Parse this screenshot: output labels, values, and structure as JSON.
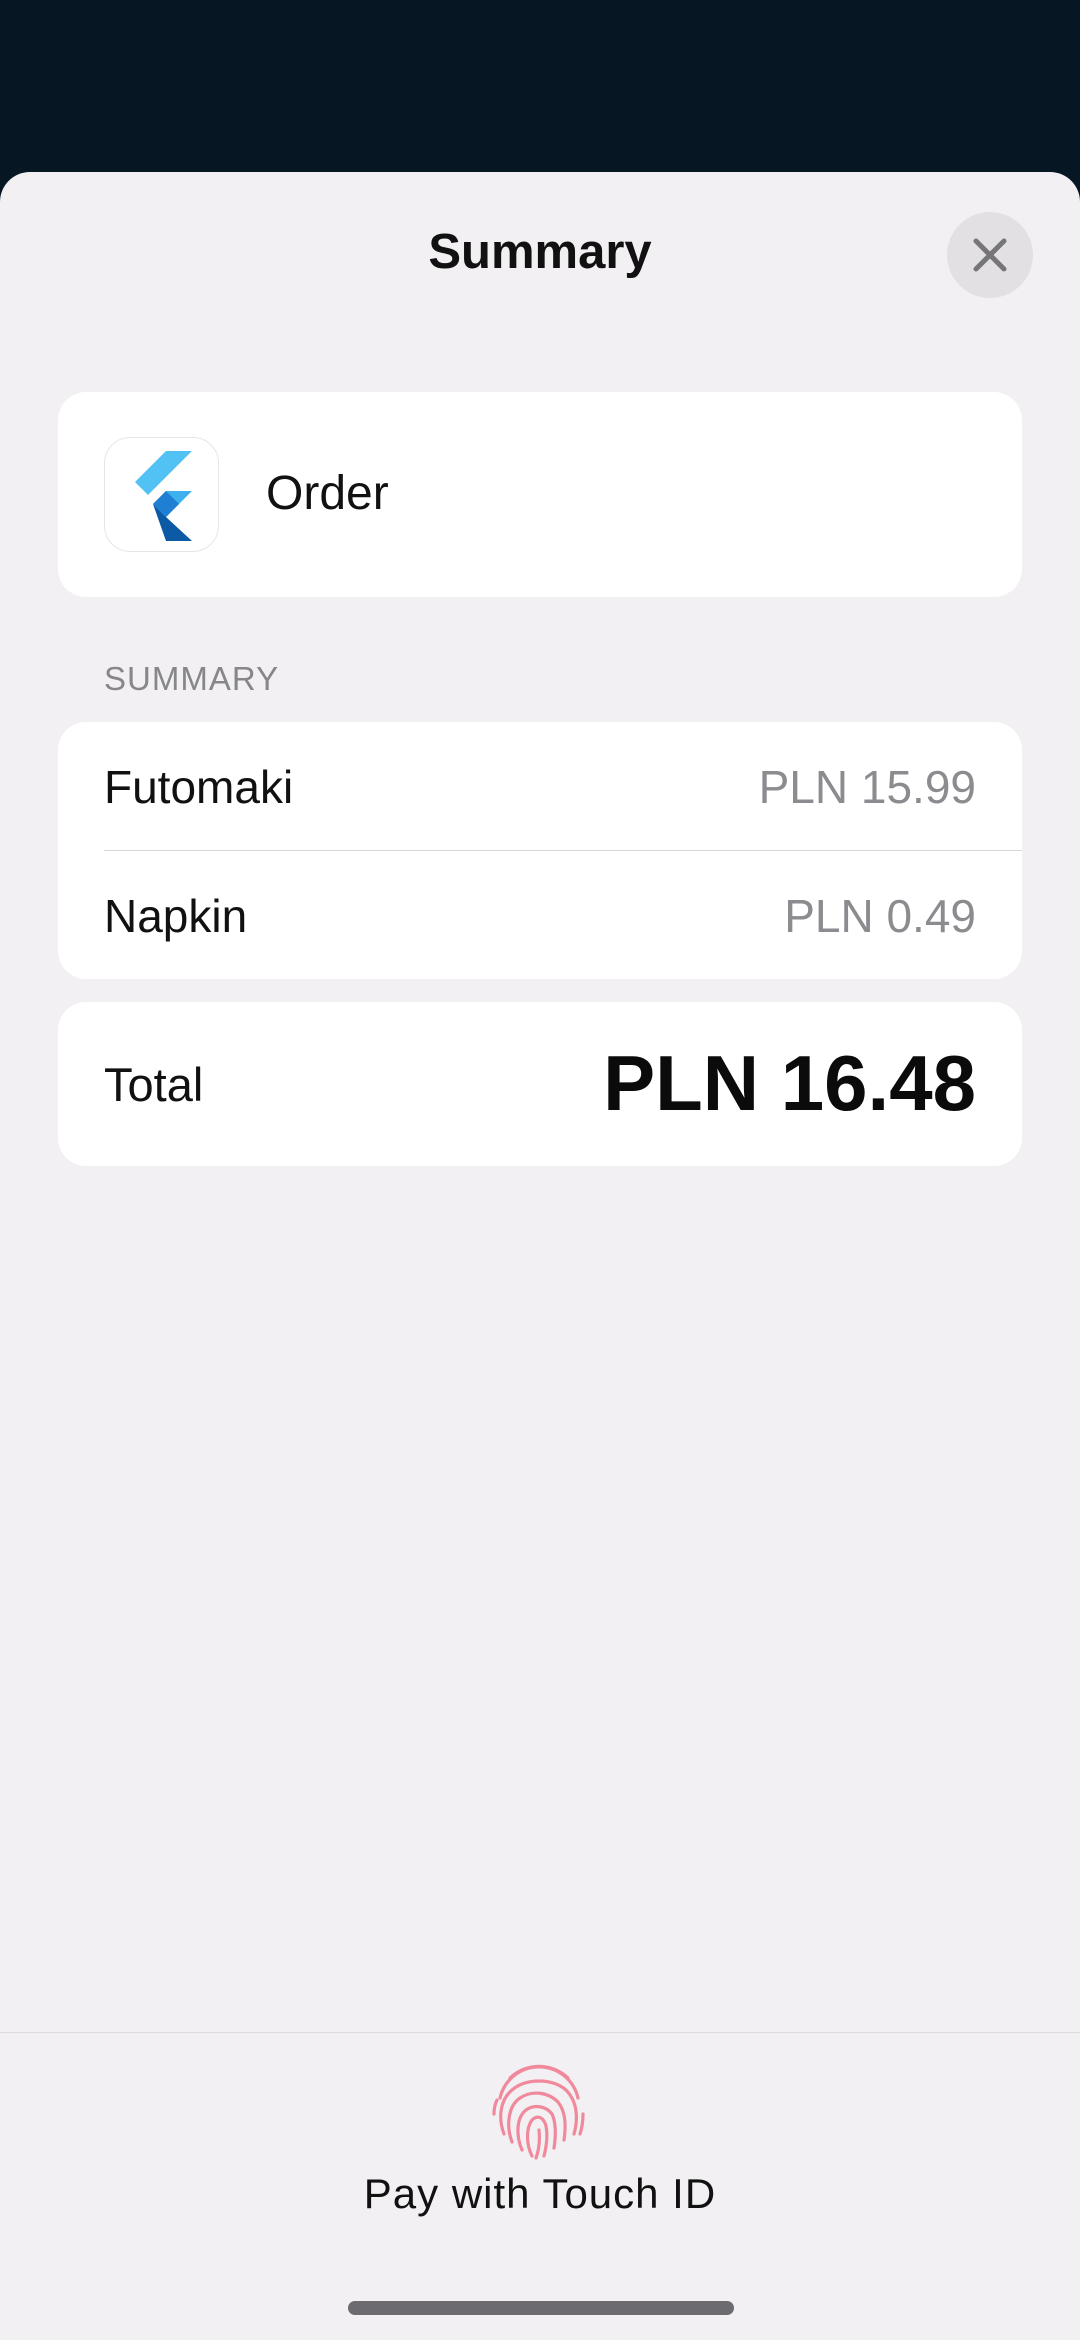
{
  "sheet": {
    "title": "Summary",
    "close_icon": "close-icon"
  },
  "order": {
    "icon": "flutter-logo-icon",
    "label": "Order"
  },
  "summary": {
    "heading": "SUMMARY",
    "items": [
      {
        "name": "Futomaki",
        "price": "PLN 15.99"
      },
      {
        "name": "Napkin",
        "price": "PLN 0.49"
      }
    ]
  },
  "total": {
    "label": "Total",
    "value": "PLN 16.48"
  },
  "footer": {
    "icon": "fingerprint-icon",
    "pay_label": "Pay with Touch ID"
  },
  "colors": {
    "backdrop": "#061622",
    "sheet": "#f2f0f2",
    "card": "#ffffff",
    "secondary_text": "#8b8b90",
    "touch_id": "#f0899c"
  }
}
